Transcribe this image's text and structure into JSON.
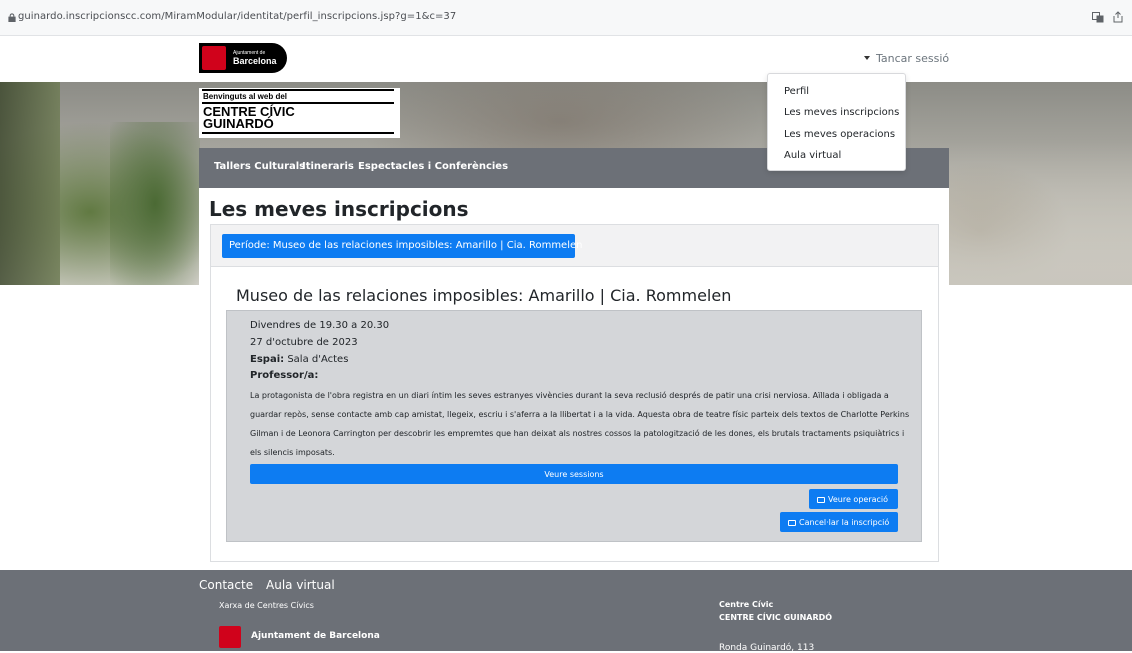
{
  "browser": {
    "url": "guinardo.inscripcionscc.com/MiramModular/identitat/perfil_inscripcions.jsp?g=1&c=37"
  },
  "header": {
    "logo_line1": "Ajuntament de",
    "logo_line2": "Barcelona",
    "logout_label": "Tancar sessió"
  },
  "hero": {
    "welcome": "Benvinguts al web del",
    "centre_line1": "CENTRE CÍVIC",
    "centre_line2": "GUINARDÓ"
  },
  "nav": {
    "items": [
      {
        "label": "Tallers Culturals"
      },
      {
        "label": "Itineraris"
      },
      {
        "label": "Espectacles i Conferències"
      }
    ]
  },
  "dropdown": {
    "items": [
      {
        "label": "Perfil"
      },
      {
        "label": "Les meves inscripcions"
      },
      {
        "label": "Les meves operacions"
      },
      {
        "label": "Aula virtual"
      }
    ]
  },
  "main": {
    "page_title": "Les meves inscripcions",
    "period_label": "Període: Museo de las relaciones imposibles: Amarillo | Cia. Rommelen",
    "event": {
      "title": "Museo de las relaciones imposibles: Amarillo | Cia. Rommelen",
      "schedule": "Divendres de 19.30 a 20.30",
      "date": "27 d'octubre de 2023",
      "space_label": "Espai:",
      "space_value": "Sala d'Actes",
      "professor_label": "Professor/a:",
      "description": "La protagonista de l'obra registra en un diari íntim les seves estranyes vivències durant la seva reclusió després de patir una crisi nerviosa. Aïllada i obligada a guardar repòs, sense contacte amb cap amistat, llegeix, escriu i s'aferra a la llibertat i a la vida. Aquesta obra de teatre físic parteix dels textos de Charlotte Perkins Gilman i de Leonora Carrington per descobrir les empremtes que han deixat als nostres cossos la patologització de les dones, els brutals tractaments psiquiàtrics i els silencis imposats.",
      "sessions_button": "Veure sessions",
      "operation_button": "Veure operació",
      "cancel_button": "Cancel·lar la inscripció"
    }
  },
  "footer": {
    "links": [
      {
        "label": "Contacte"
      },
      {
        "label": "Aula virtual"
      }
    ],
    "network": "Xarxa de Centres Cívics",
    "ajuntament": "Ajuntament de Barcelona",
    "centre_label": "Centre Cívic",
    "centre_name": "CENTRE CÍVIC GUINARDÓ",
    "address": "Ronda Guinardó, 113"
  },
  "colors": {
    "primary": "#0d7cf2",
    "nav_gray": "#6c7077",
    "panel_gray": "#d4d6d9",
    "brand_red": "#d0021b"
  }
}
